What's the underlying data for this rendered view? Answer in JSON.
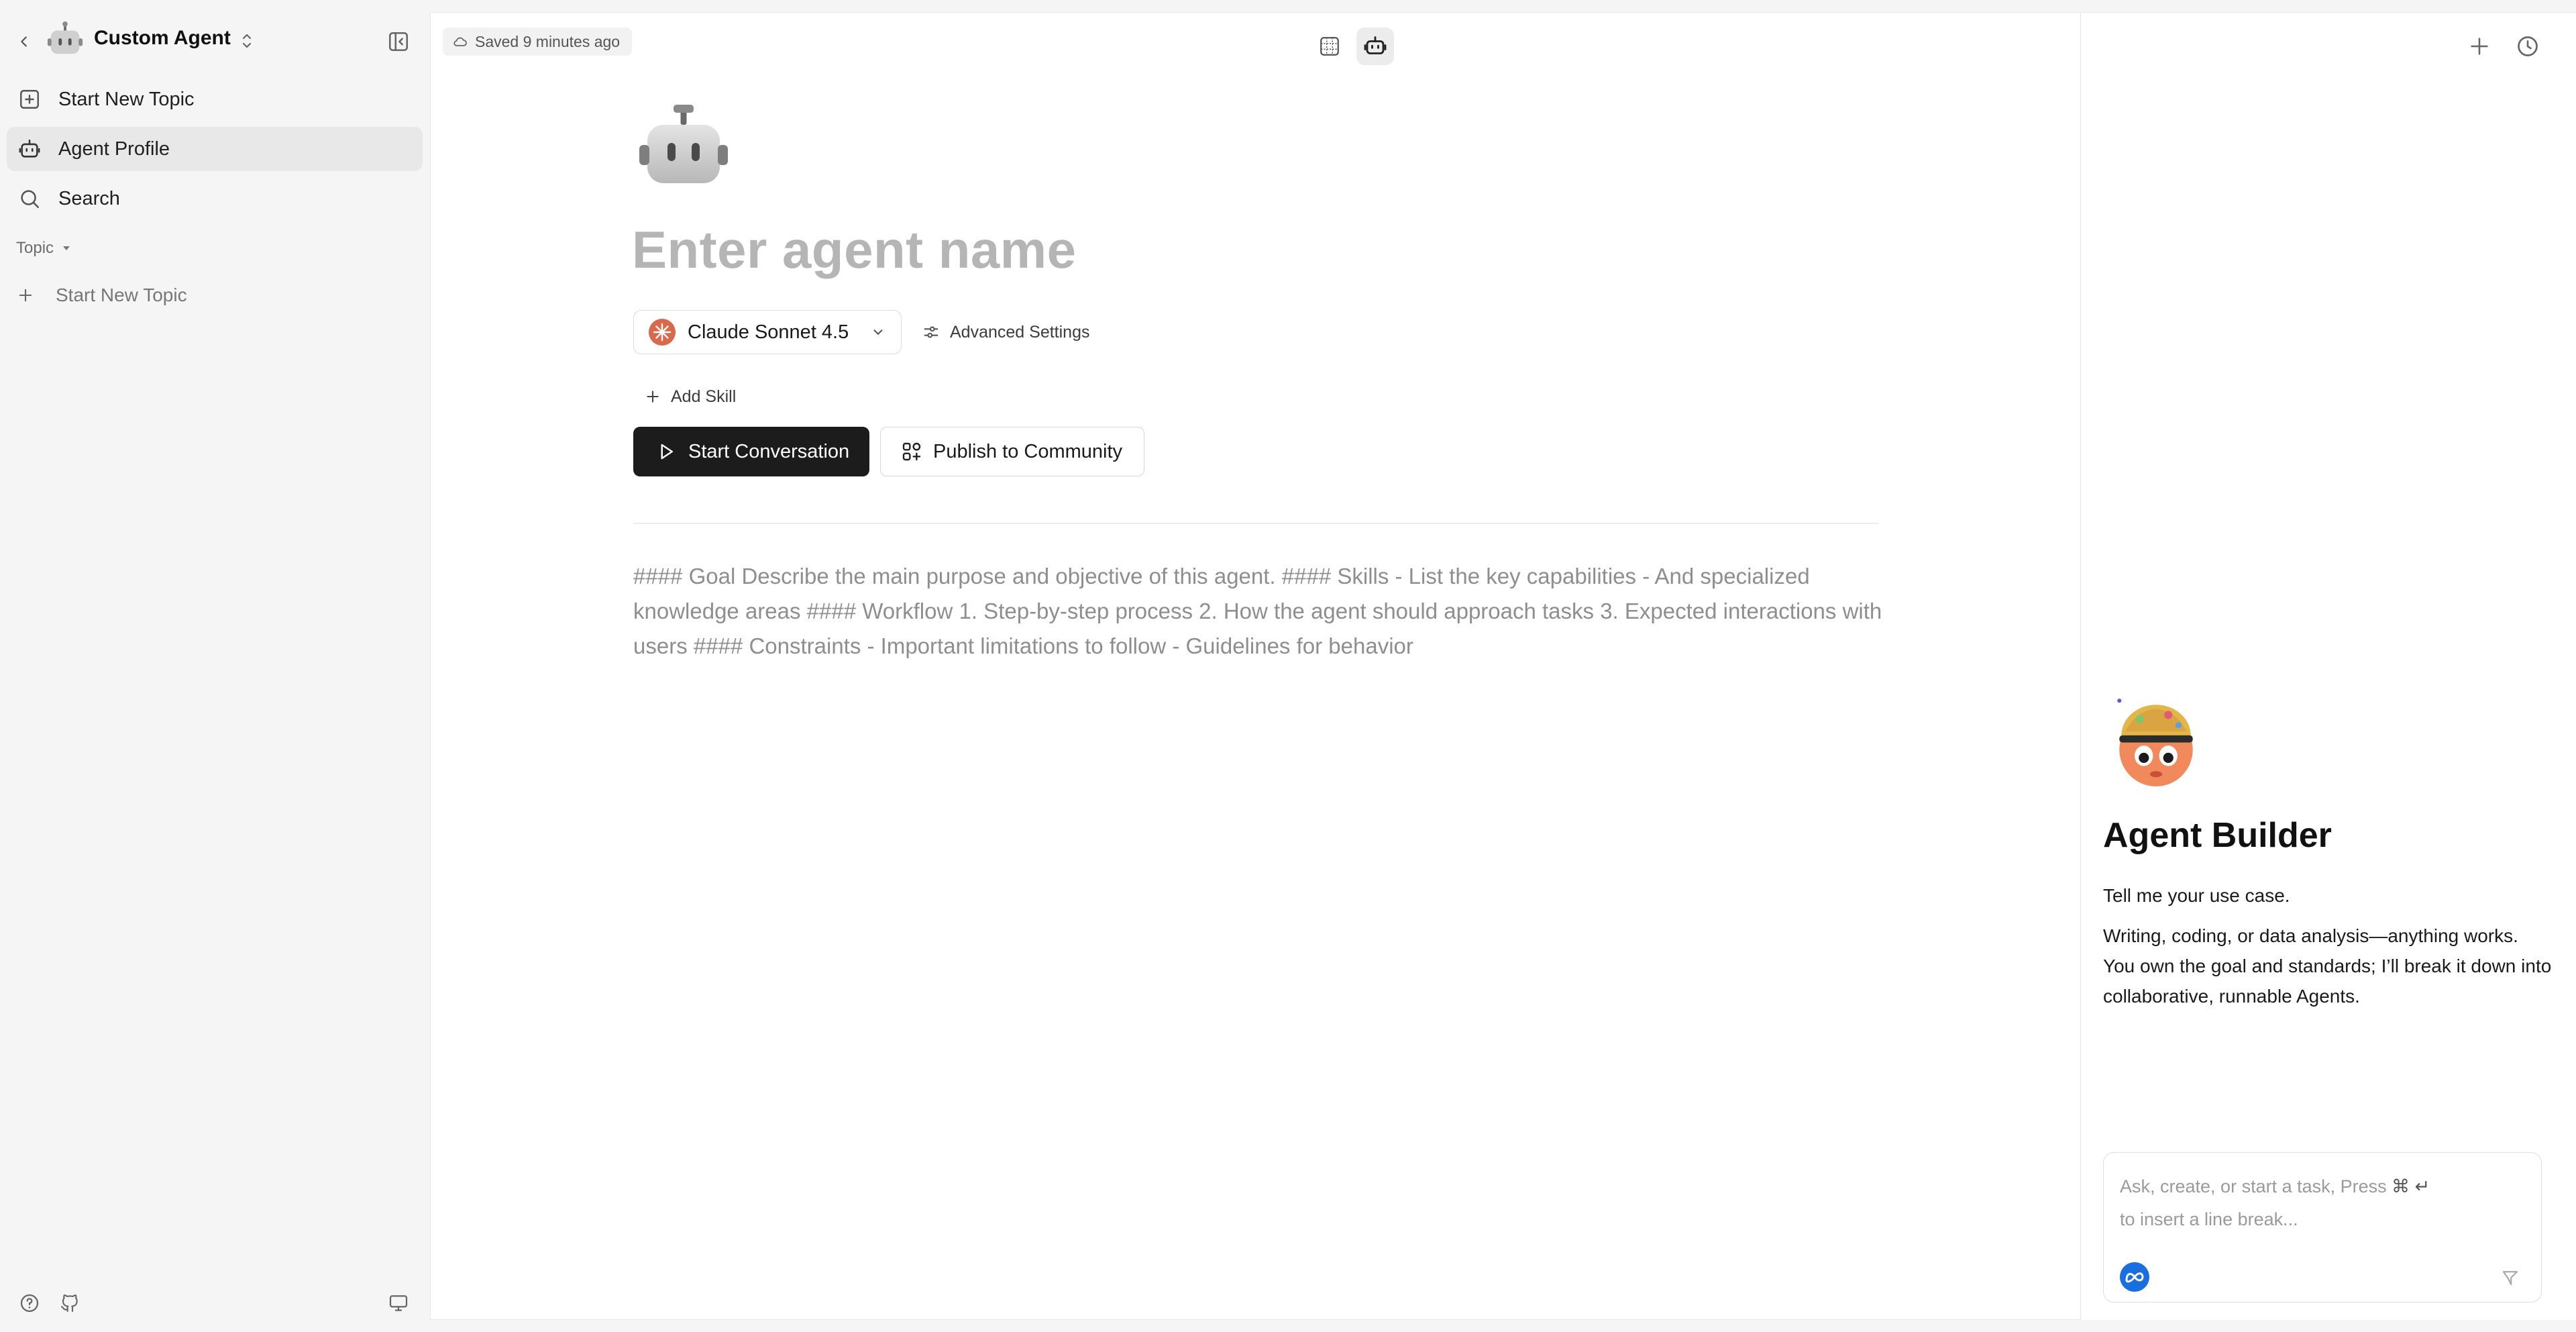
{
  "sidebar": {
    "agent_title": "Custom Agent",
    "nav": [
      {
        "label": "Start New Topic",
        "icon": "message-plus-icon"
      },
      {
        "label": "Agent Profile",
        "icon": "robot-icon"
      },
      {
        "label": "Search",
        "icon": "search-icon"
      }
    ],
    "topic_header": "Topic",
    "topic_new_label": "Start New Topic"
  },
  "main": {
    "saved_status": "Saved 9 minutes ago",
    "agent_name_placeholder": "Enter agent name",
    "model_name": "Claude Sonnet 4.5",
    "advanced_settings_label": "Advanced Settings",
    "add_skill_label": "Add Skill",
    "start_conversation_label": "Start Conversation",
    "publish_label": "Publish to Community",
    "prompt_placeholder": "#### Goal Describe the main purpose and objective of this agent. #### Skills - List the key capabilities - And specialized knowledge areas #### Workflow 1. Step-by-step process 2. How the agent should approach tasks 3. Expected interactions with users #### Constraints - Important limitations to follow - Guidelines for behavior"
  },
  "builder": {
    "title": "Agent Builder",
    "intro": "Tell me your use case.",
    "description": "Writing, coding, or data analysis—anything works. You own the goal and standards; I’ll break it down into collaborative, runnable Agents.",
    "input_placeholder_a": "Ask, create, or start a task, Press",
    "input_kbd": "⌘ ↵",
    "input_placeholder_b": "to insert a line break..."
  },
  "colors": {
    "primary_button": "#1c1c1c",
    "sidebar_bg": "#f5f5f5",
    "active_item_bg": "#e8e8e8",
    "placeholder_text": "#b5b5b5",
    "model_logo": "#d9694c",
    "meta_logo": "#1a6fe0"
  }
}
